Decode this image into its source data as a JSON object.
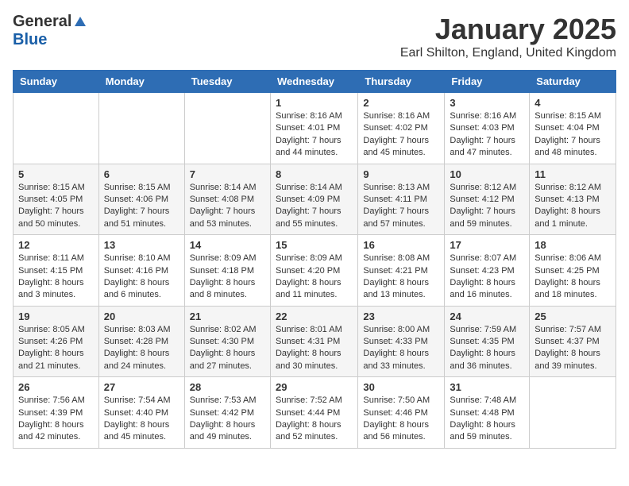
{
  "header": {
    "logo_general": "General",
    "logo_blue": "Blue",
    "month_title": "January 2025",
    "location": "Earl Shilton, England, United Kingdom"
  },
  "days_of_week": [
    "Sunday",
    "Monday",
    "Tuesday",
    "Wednesday",
    "Thursday",
    "Friday",
    "Saturday"
  ],
  "weeks": [
    [
      {
        "day": "",
        "info": ""
      },
      {
        "day": "",
        "info": ""
      },
      {
        "day": "",
        "info": ""
      },
      {
        "day": "1",
        "info": "Sunrise: 8:16 AM\nSunset: 4:01 PM\nDaylight: 7 hours\nand 44 minutes."
      },
      {
        "day": "2",
        "info": "Sunrise: 8:16 AM\nSunset: 4:02 PM\nDaylight: 7 hours\nand 45 minutes."
      },
      {
        "day": "3",
        "info": "Sunrise: 8:16 AM\nSunset: 4:03 PM\nDaylight: 7 hours\nand 47 minutes."
      },
      {
        "day": "4",
        "info": "Sunrise: 8:15 AM\nSunset: 4:04 PM\nDaylight: 7 hours\nand 48 minutes."
      }
    ],
    [
      {
        "day": "5",
        "info": "Sunrise: 8:15 AM\nSunset: 4:05 PM\nDaylight: 7 hours\nand 50 minutes."
      },
      {
        "day": "6",
        "info": "Sunrise: 8:15 AM\nSunset: 4:06 PM\nDaylight: 7 hours\nand 51 minutes."
      },
      {
        "day": "7",
        "info": "Sunrise: 8:14 AM\nSunset: 4:08 PM\nDaylight: 7 hours\nand 53 minutes."
      },
      {
        "day": "8",
        "info": "Sunrise: 8:14 AM\nSunset: 4:09 PM\nDaylight: 7 hours\nand 55 minutes."
      },
      {
        "day": "9",
        "info": "Sunrise: 8:13 AM\nSunset: 4:11 PM\nDaylight: 7 hours\nand 57 minutes."
      },
      {
        "day": "10",
        "info": "Sunrise: 8:12 AM\nSunset: 4:12 PM\nDaylight: 7 hours\nand 59 minutes."
      },
      {
        "day": "11",
        "info": "Sunrise: 8:12 AM\nSunset: 4:13 PM\nDaylight: 8 hours\nand 1 minute."
      }
    ],
    [
      {
        "day": "12",
        "info": "Sunrise: 8:11 AM\nSunset: 4:15 PM\nDaylight: 8 hours\nand 3 minutes."
      },
      {
        "day": "13",
        "info": "Sunrise: 8:10 AM\nSunset: 4:16 PM\nDaylight: 8 hours\nand 6 minutes."
      },
      {
        "day": "14",
        "info": "Sunrise: 8:09 AM\nSunset: 4:18 PM\nDaylight: 8 hours\nand 8 minutes."
      },
      {
        "day": "15",
        "info": "Sunrise: 8:09 AM\nSunset: 4:20 PM\nDaylight: 8 hours\nand 11 minutes."
      },
      {
        "day": "16",
        "info": "Sunrise: 8:08 AM\nSunset: 4:21 PM\nDaylight: 8 hours\nand 13 minutes."
      },
      {
        "day": "17",
        "info": "Sunrise: 8:07 AM\nSunset: 4:23 PM\nDaylight: 8 hours\nand 16 minutes."
      },
      {
        "day": "18",
        "info": "Sunrise: 8:06 AM\nSunset: 4:25 PM\nDaylight: 8 hours\nand 18 minutes."
      }
    ],
    [
      {
        "day": "19",
        "info": "Sunrise: 8:05 AM\nSunset: 4:26 PM\nDaylight: 8 hours\nand 21 minutes."
      },
      {
        "day": "20",
        "info": "Sunrise: 8:03 AM\nSunset: 4:28 PM\nDaylight: 8 hours\nand 24 minutes."
      },
      {
        "day": "21",
        "info": "Sunrise: 8:02 AM\nSunset: 4:30 PM\nDaylight: 8 hours\nand 27 minutes."
      },
      {
        "day": "22",
        "info": "Sunrise: 8:01 AM\nSunset: 4:31 PM\nDaylight: 8 hours\nand 30 minutes."
      },
      {
        "day": "23",
        "info": "Sunrise: 8:00 AM\nSunset: 4:33 PM\nDaylight: 8 hours\nand 33 minutes."
      },
      {
        "day": "24",
        "info": "Sunrise: 7:59 AM\nSunset: 4:35 PM\nDaylight: 8 hours\nand 36 minutes."
      },
      {
        "day": "25",
        "info": "Sunrise: 7:57 AM\nSunset: 4:37 PM\nDaylight: 8 hours\nand 39 minutes."
      }
    ],
    [
      {
        "day": "26",
        "info": "Sunrise: 7:56 AM\nSunset: 4:39 PM\nDaylight: 8 hours\nand 42 minutes."
      },
      {
        "day": "27",
        "info": "Sunrise: 7:54 AM\nSunset: 4:40 PM\nDaylight: 8 hours\nand 45 minutes."
      },
      {
        "day": "28",
        "info": "Sunrise: 7:53 AM\nSunset: 4:42 PM\nDaylight: 8 hours\nand 49 minutes."
      },
      {
        "day": "29",
        "info": "Sunrise: 7:52 AM\nSunset: 4:44 PM\nDaylight: 8 hours\nand 52 minutes."
      },
      {
        "day": "30",
        "info": "Sunrise: 7:50 AM\nSunset: 4:46 PM\nDaylight: 8 hours\nand 56 minutes."
      },
      {
        "day": "31",
        "info": "Sunrise: 7:48 AM\nSunset: 4:48 PM\nDaylight: 8 hours\nand 59 minutes."
      },
      {
        "day": "",
        "info": ""
      }
    ]
  ]
}
